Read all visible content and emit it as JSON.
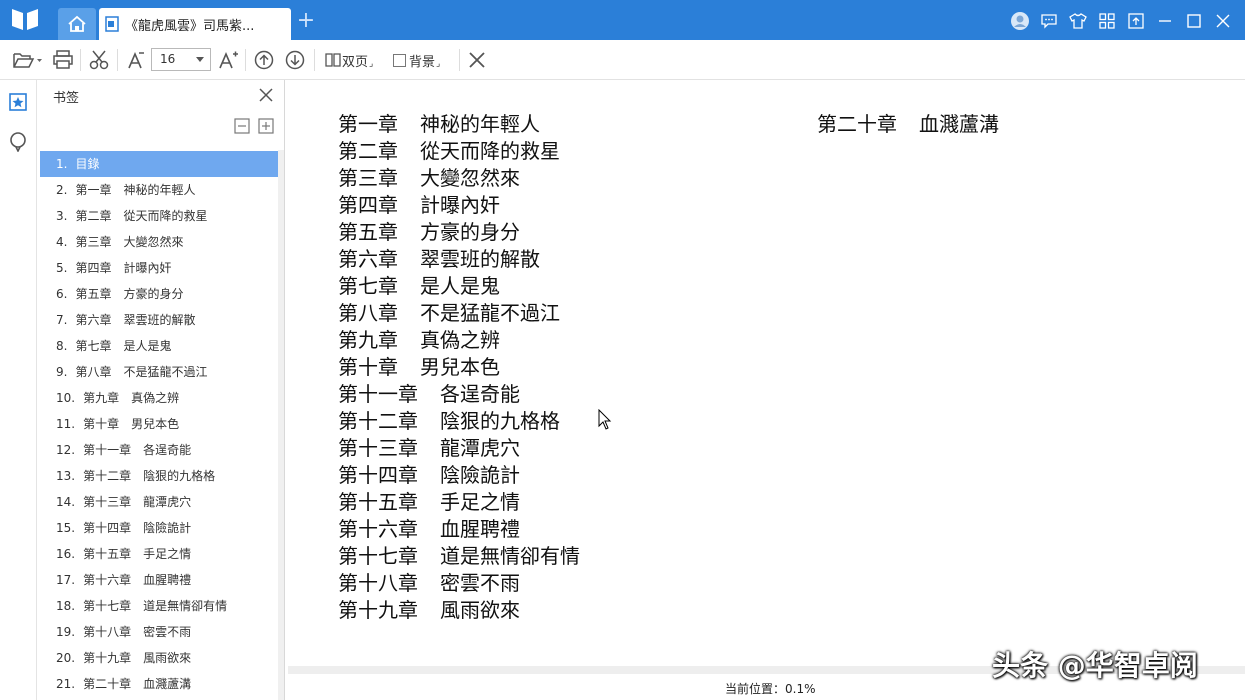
{
  "titlebar": {
    "doc_tab_label": "《龍虎風雲》司馬紫...",
    "new_tab": "+"
  },
  "toolbar": {
    "font_size": "16",
    "double_page_label": "双页",
    "background_label": "背景"
  },
  "panel": {
    "title": "书签",
    "items": [
      {
        "num": "1.",
        "label": "目錄"
      },
      {
        "num": "2.",
        "label": "第一章　神秘的年輕人"
      },
      {
        "num": "3.",
        "label": "第二章　從天而降的救星"
      },
      {
        "num": "4.",
        "label": "第三章　大變忽然來"
      },
      {
        "num": "5.",
        "label": "第四章　計曝內奸"
      },
      {
        "num": "6.",
        "label": "第五章　方豪的身分"
      },
      {
        "num": "7.",
        "label": "第六章　翠雲班的解散"
      },
      {
        "num": "8.",
        "label": "第七章　是人是鬼"
      },
      {
        "num": "9.",
        "label": "第八章　不是猛龍不過江"
      },
      {
        "num": "10.",
        "label": "第九章　真偽之辨"
      },
      {
        "num": "11.",
        "label": "第十章　男兒本色"
      },
      {
        "num": "12.",
        "label": "第十一章　各逞奇能"
      },
      {
        "num": "13.",
        "label": "第十二章　陰狠的九格格"
      },
      {
        "num": "14.",
        "label": "第十三章　龍潭虎穴"
      },
      {
        "num": "15.",
        "label": "第十四章　陰險詭計"
      },
      {
        "num": "16.",
        "label": "第十五章　手足之情"
      },
      {
        "num": "17.",
        "label": "第十六章　血腥聘禮"
      },
      {
        "num": "18.",
        "label": "第十七章　道是無情卻有情"
      },
      {
        "num": "19.",
        "label": "第十八章　密雲不雨"
      },
      {
        "num": "20.",
        "label": "第十九章　風雨欲來"
      },
      {
        "num": "21.",
        "label": "第二十章　血濺蘆溝"
      }
    ]
  },
  "content": {
    "left_column": [
      {
        "chapter": "第一章",
        "title": "神秘的年輕人"
      },
      {
        "chapter": "第二章",
        "title": "從天而降的救星"
      },
      {
        "chapter": "第三章",
        "title": "大變忽然來"
      },
      {
        "chapter": "第四章",
        "title": "計曝內奸"
      },
      {
        "chapter": "第五章",
        "title": "方豪的身分"
      },
      {
        "chapter": "第六章",
        "title": "翠雲班的解散"
      },
      {
        "chapter": "第七章",
        "title": "是人是鬼"
      },
      {
        "chapter": "第八章",
        "title": "不是猛龍不過江"
      },
      {
        "chapter": "第九章",
        "title": "真偽之辨"
      },
      {
        "chapter": "第十章",
        "title": "男兒本色"
      },
      {
        "chapter": "第十一章",
        "title": "各逞奇能"
      },
      {
        "chapter": "第十二章",
        "title": "陰狠的九格格"
      },
      {
        "chapter": "第十三章",
        "title": "龍潭虎穴"
      },
      {
        "chapter": "第十四章",
        "title": "陰險詭計"
      },
      {
        "chapter": "第十五章",
        "title": "手足之情"
      },
      {
        "chapter": "第十六章",
        "title": "血腥聘禮"
      },
      {
        "chapter": "第十七章",
        "title": "道是無情卻有情"
      },
      {
        "chapter": "第十八章",
        "title": "密雲不雨"
      },
      {
        "chapter": "第十九章",
        "title": "風雨欲來"
      }
    ],
    "right_column": [
      {
        "chapter": "第二十章",
        "title": "血濺蘆溝"
      }
    ]
  },
  "status": {
    "position_text": "当前位置：0.1%"
  },
  "watermark": "头条 @华智卓阅",
  "colors": {
    "titlebar": "#2b7fd8",
    "selected_item": "#6fa8ef",
    "accent_icon": "#2b7fd8"
  },
  "icons": {
    "logo": "book-logo-icon",
    "home": "home-icon",
    "doc": "document-icon",
    "user": "user-avatar-icon",
    "feedback": "chat-icon",
    "skin": "shirt-icon",
    "apps": "grid-icon",
    "upload": "upload-icon",
    "minimize": "minimize-icon",
    "maximize": "maximize-icon",
    "close": "close-icon"
  }
}
